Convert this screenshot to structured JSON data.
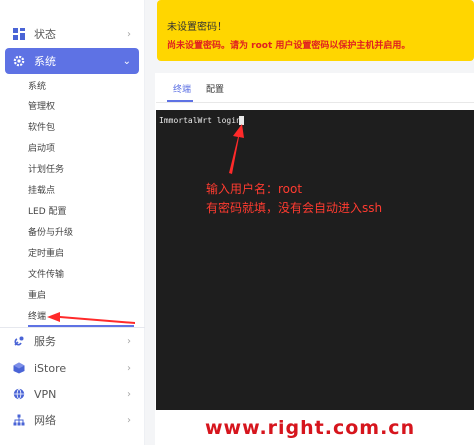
{
  "sidebar": {
    "menu": [
      {
        "label": "状态",
        "icon": "dashboard-icon",
        "expanded": false
      },
      {
        "label": "系统",
        "icon": "gear-icon",
        "expanded": true
      },
      {
        "label": "服务",
        "icon": "services-icon",
        "expanded": false
      },
      {
        "label": "iStore",
        "icon": "istore-icon",
        "expanded": false
      },
      {
        "label": "VPN",
        "icon": "globe-icon",
        "expanded": false
      },
      {
        "label": "网络",
        "icon": "network-icon",
        "expanded": false
      }
    ],
    "system_submenu": [
      "系统",
      "管理权",
      "软件包",
      "启动项",
      "计划任务",
      "挂载点",
      "LED 配置",
      "备份与升级",
      "定时重启",
      "文件传输",
      "重启",
      "终端"
    ],
    "active_subitem": "终端"
  },
  "alert": {
    "title": "未设置密码！",
    "message": "尚未设置密码。请为 root 用户设置密码以保护主机并启用。",
    "color": "#ffd600"
  },
  "tabs": [
    {
      "label": "终端",
      "active": true
    },
    {
      "label": "配置",
      "active": false
    }
  ],
  "terminal": {
    "prompt": "ImmortalWrt login: "
  },
  "annotation": {
    "line1": "输入用户名：root",
    "line2": "有密码就填，没有会自动进入ssh",
    "color": "#ff3b30"
  },
  "watermark": "www.right.com.cn",
  "colors": {
    "accent": "#5e72e4",
    "alert_bg": "#ffd600",
    "terminal_bg": "#1e1e1e"
  }
}
